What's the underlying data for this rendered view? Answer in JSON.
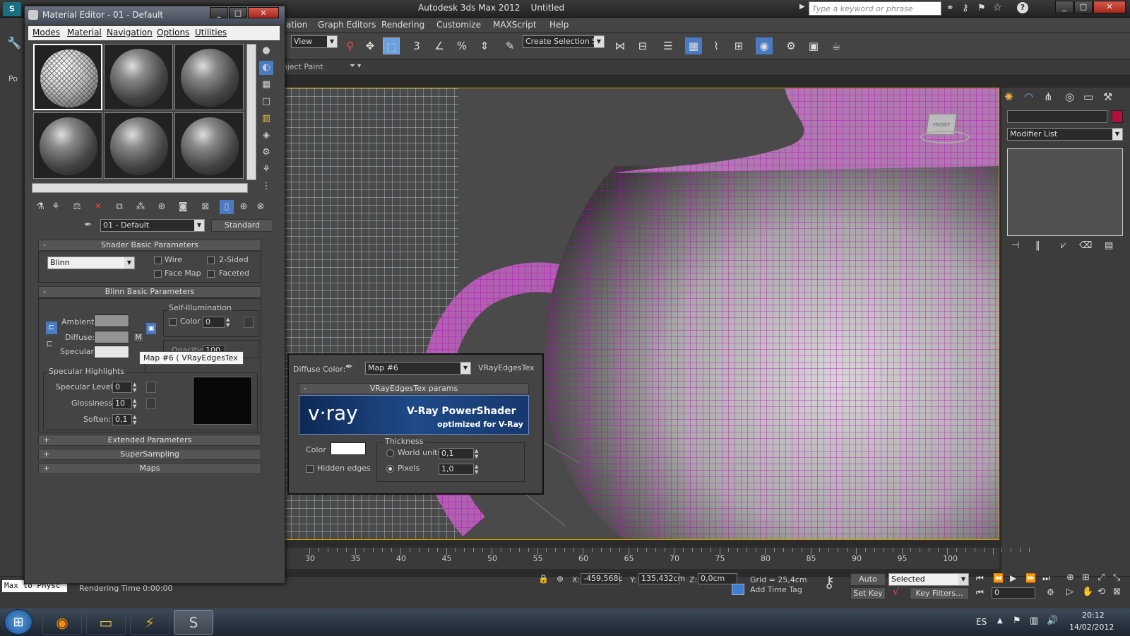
{
  "app": {
    "title": "Autodesk 3ds Max 2012",
    "doc": "Untitled",
    "search_placeholder": "Type a keyword or phrase"
  },
  "main_menu": [
    "ation",
    "Graph Editors",
    "Rendering",
    "Customize",
    "MAXScript",
    "Help"
  ],
  "toolbar": {
    "view_dropdown": "View",
    "selection_set": "Create Selection Se",
    "sub_label": "oject Paint"
  },
  "left_tab": "Po",
  "material_editor": {
    "title": "Material Editor - 01 - Default",
    "menu": [
      "Modes",
      "Material",
      "Navigation",
      "Options",
      "Utilities"
    ],
    "material_name": "01 - Default",
    "material_type": "Standard",
    "shader_basic": {
      "header": "Shader Basic Parameters",
      "shader": "Blinn",
      "wire": "Wire",
      "two_sided": "2-Sided",
      "face_map": "Face Map",
      "faceted": "Faceted"
    },
    "blinn_basic": {
      "header": "Blinn Basic Parameters",
      "self_illum": "Self-Illumination",
      "color": "Color",
      "color_value": "0",
      "ambient": "Ambient:",
      "diffuse": "Diffuse:",
      "specular": "Specular:",
      "m_button": "M",
      "opacity": "Opacity:",
      "opacity_value": "100"
    },
    "specular_highlights": {
      "header": "Specular Highlights",
      "level_label": "Specular Level:",
      "level_value": "0",
      "gloss_label": "Glossiness:",
      "gloss_value": "10",
      "soften_label": "Soften:",
      "soften_value": "0,1"
    },
    "rollouts": [
      "Extended Parameters",
      "SuperSampling",
      "Maps"
    ]
  },
  "tooltip": "Map #6  ( VRayEdgesTex )",
  "vray_panel": {
    "diffuse_label": "Diffuse Color:",
    "map_name": "Map #6",
    "map_type": "VRayEdgesTex",
    "params_header": "VRayEdgesTex params",
    "logo_text": "v·ray",
    "banner_title": "V-Ray PowerShader",
    "banner_sub": "optimized for V-Ray",
    "color_label": "Color",
    "thickness": "Thickness",
    "world_units": "World units",
    "world_units_value": "0,1",
    "pixels": "Pixels",
    "pixels_value": "1,0",
    "hidden_edges": "Hidden edges"
  },
  "command_panel": {
    "modifier_list": "Modifier List"
  },
  "timeline_ticks": [
    "30",
    "35",
    "40",
    "45",
    "50",
    "55",
    "60",
    "65",
    "70",
    "75",
    "80",
    "85",
    "90",
    "95",
    "100"
  ],
  "status": {
    "max_to_physc": "Max to Physc",
    "rendering_time": "Rendering Time  0:00:00",
    "x_label": "X:",
    "x_value": "-459,568c",
    "y_label": "Y:",
    "y_value": "135,432cm",
    "z_label": "Z:",
    "z_value": "0,0cm",
    "grid": "Grid = 25,4cm",
    "add_time_tag": "Add Time Tag",
    "auto_key": "Auto Key",
    "selected": "Selected",
    "set_key": "Set Key",
    "key_filters": "Key Filters...",
    "frame": "0"
  },
  "taskbar": {
    "lang": "ES",
    "time": "20:12",
    "date": "14/02/2012"
  },
  "colors": {
    "wire": "#c000c0",
    "viewport_border": "#c8a000",
    "accent_blue": "#2f66b0"
  }
}
